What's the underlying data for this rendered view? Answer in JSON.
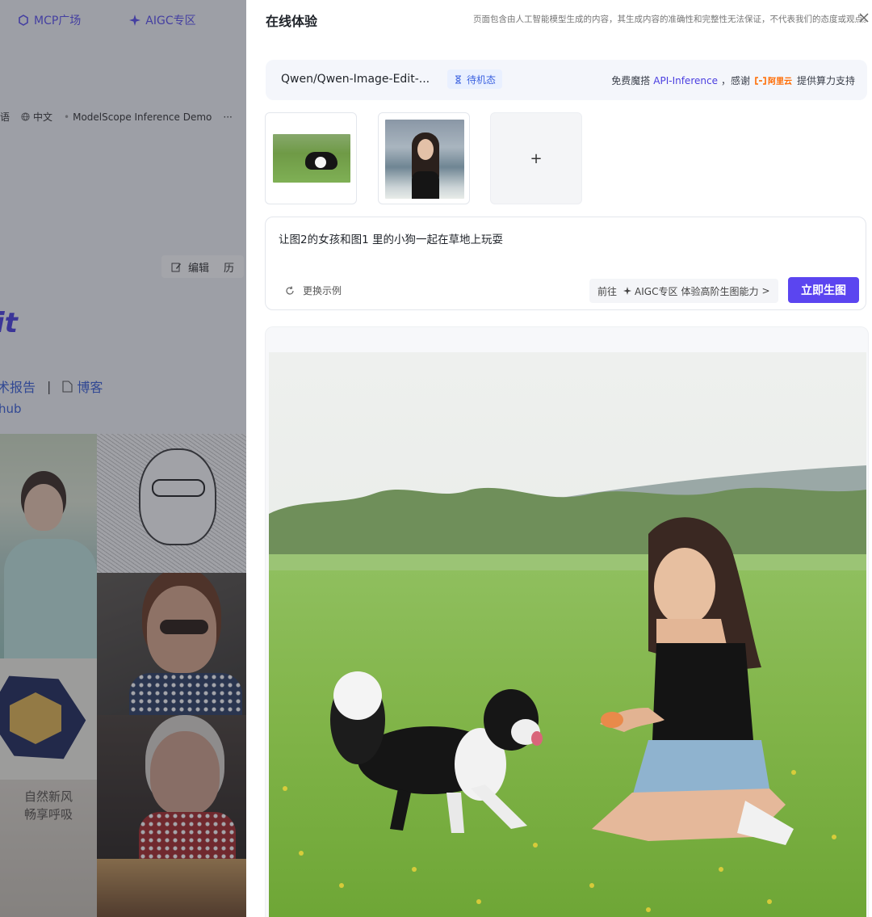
{
  "background": {
    "nav": {
      "mcp_label": "MCP广场",
      "aigc_label": "AIGC专区"
    },
    "tags": {
      "lang_partial": "语",
      "language": "中文",
      "demo": "ModelScope Inference Demo",
      "more": "···"
    },
    "edit_label": "编辑",
    "edit_next": "历",
    "title_fragment": "it",
    "links": {
      "report_partial": "术报告",
      "separator": "|",
      "blog": "博客"
    },
    "hub_partial": "hub",
    "calligraphy": "自然新风\n畅享呼吸"
  },
  "panel": {
    "title": "在线体验",
    "notice": "页面包含由人工智能模型生成的内容，其生成内容的准确性和完整性无法保证，不代表我们的态度或观点。",
    "model": {
      "name": "Qwen/Qwen-Image-Edit-...",
      "status": "待机态",
      "credit_prefix": "免费魔搭",
      "credit_api": "API-Inference",
      "credit_thanks": "，感谢",
      "aliyun_label": "阿里云",
      "credit_suffix": "提供算力支持"
    },
    "upload_add_label": "+",
    "prompt": {
      "text": "让图2的女孩和图1 里的小狗一起在草地上玩耍",
      "example_label": "更换示例",
      "aigc_prefix": "前往",
      "aigc_label": "AIGC专区",
      "aigc_suffix": "体验高阶生图能力",
      "aigc_chevron": ">",
      "generate_label": "立即生图"
    }
  },
  "colors": {
    "accent": "#5b45f0",
    "badge_bg": "#e9f0ff",
    "badge_text": "#3d63e0",
    "aliyun": "#ff6a00"
  },
  "icons": [
    "sparkle-icon",
    "globe-icon",
    "edit-icon",
    "doc-icon",
    "hourglass-icon",
    "close-icon",
    "refresh-icon",
    "aliyun-logo",
    "chevron-right-icon"
  ]
}
